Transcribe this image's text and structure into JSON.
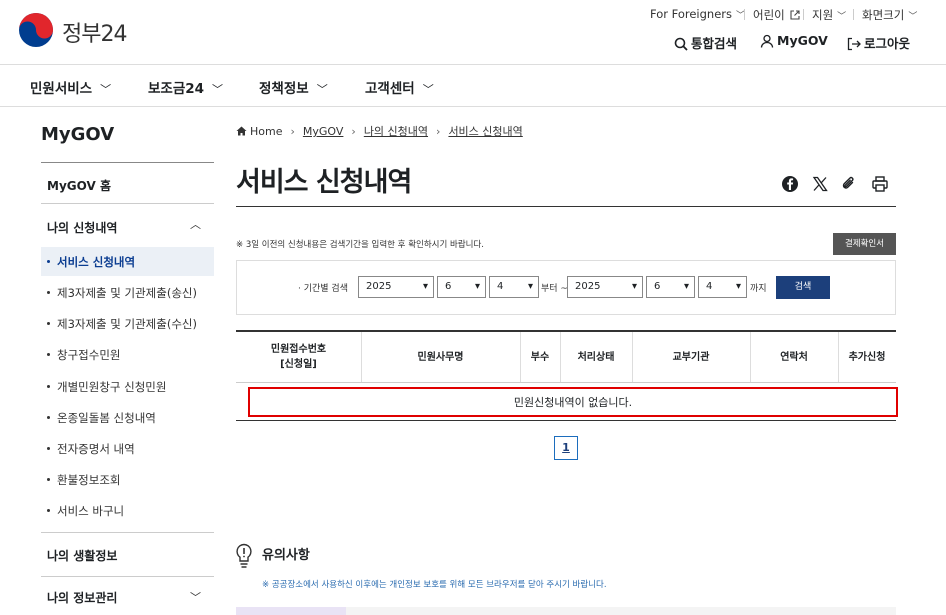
{
  "header": {
    "logo_text": "정부24",
    "util": {
      "foreigners": "For Foreigners",
      "kids": "어린이",
      "support": "지원",
      "zoom": "화면크기"
    },
    "actions": {
      "search": "통합검색",
      "mygov": "MyGOV",
      "logout": "로그아웃"
    }
  },
  "gnb": [
    "민원서비스",
    "보조금24",
    "정책정보",
    "고객센터"
  ],
  "sidebar": {
    "title": "MyGOV",
    "home": "MyGOV 홈",
    "section1": "나의 신청내역",
    "items": [
      "서비스 신청내역",
      "제3자제출 및 기관제출(송신)",
      "제3자제출 및 기관제출(수신)",
      "창구접수민원",
      "개별민원창구 신청민원",
      "온종일돌봄 신청내역",
      "전자증명서 내역",
      "환불정보조회",
      "서비스 바구니"
    ],
    "section2": "나의 생활정보",
    "section3": "나의 정보관리"
  },
  "breadcrumb": [
    "Home",
    "MyGOV",
    "나의 신청내역",
    "서비스 신청내역"
  ],
  "page_title": "서비스 신청내역",
  "notice": "※ 3일 이전의 신청내용은 검색기간을 입력한 후 확인하시기 바랍니다.",
  "cert_button": "결제확인서",
  "search": {
    "label": "· 기간별 검색",
    "from": {
      "year": "2025",
      "month": "6",
      "day": "4"
    },
    "from_suffix": "부터 ~",
    "to": {
      "year": "2025",
      "month": "6",
      "day": "4"
    },
    "to_suffix": "까지",
    "button": "검색"
  },
  "table": {
    "headers": [
      "민원접수번호\n[신청일]",
      "민원사무명",
      "부수",
      "처리상태",
      "교부기관",
      "연락처",
      "추가신청"
    ],
    "empty_message": "민원신청내역이 없습니다."
  },
  "pagination": {
    "current": "1"
  },
  "caution": {
    "title": "유의사항",
    "text": "※ 공공장소에서 사용하신 이후에는 개인정보 보호를 위해 모든 브라우저를 닫아 주시기 바랍니다."
  },
  "colors": {
    "primary": "#1c3f7b",
    "highlight_border": "#e00000",
    "active_bg": "#ebf0f6"
  }
}
